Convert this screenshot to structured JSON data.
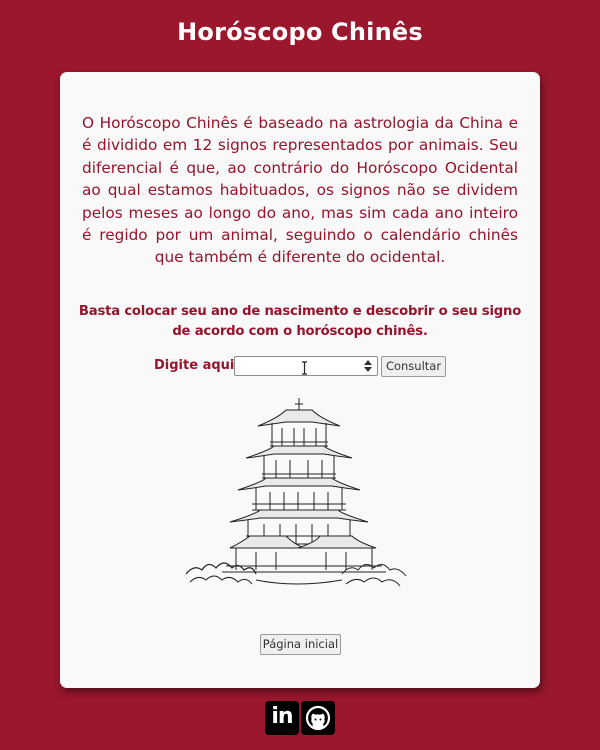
{
  "header": {
    "title": "Horóscopo Chinês"
  },
  "main": {
    "intro_text": "O Horóscopo Chinês é baseado na astrologia da China e é dividido em 12 signos representados por animais. Seu diferencial é que, ao contrário do Horóscopo Ocidental ao qual estamos habituados, os signos não se dividem pelos meses ao longo do ano, mas sim cada ano inteiro é regido por um animal, seguindo o calendário chinês que também é diferente do ocidental.",
    "hint_text": "Basta colocar seu ano de nascimento e descobrir o seu signo de acordo com o horóscopo chinês.",
    "form": {
      "label": "Digite aqui:",
      "year_value": "",
      "placeholder": "",
      "button_label": "Consultar"
    },
    "illustration": "pagoda-illustration",
    "home_button_label": "Página inicial"
  },
  "footer": {
    "social_icons": [
      "linkedin-icon",
      "github-icon"
    ]
  },
  "colors": {
    "background": "#9a172d",
    "card": "#f8f9f8",
    "accent_text": "#96142c",
    "title": "#ffffff"
  }
}
